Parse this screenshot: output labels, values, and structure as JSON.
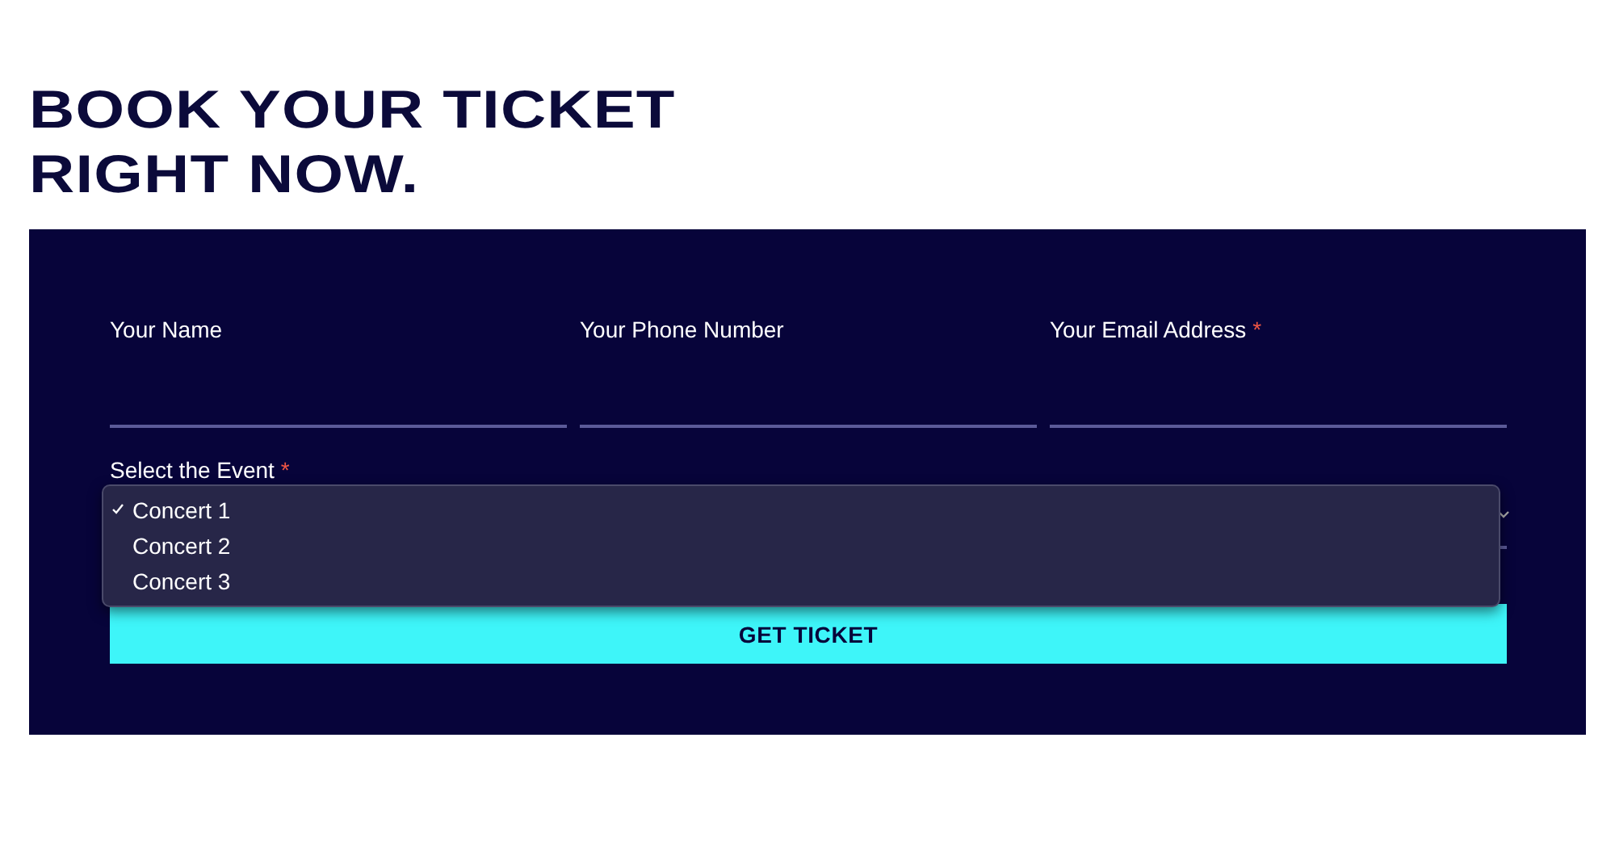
{
  "heading": [
    "BOOK YOUR TICKET",
    "RIGHT NOW."
  ],
  "fields": [
    {
      "label": "Your Name"
    },
    {
      "label": "Your Phone Number"
    },
    {
      "label": "Your Email Address",
      "required_mark": "*"
    }
  ],
  "event_select": {
    "label": "Select the Event",
    "required_mark": "*",
    "expanded": true,
    "options": [
      {
        "label": "Concert 1",
        "selected": true
      },
      {
        "label": "Concert 2",
        "selected": false
      },
      {
        "label": "Concert 3",
        "selected": false
      }
    ]
  },
  "button": "GET TICKET"
}
